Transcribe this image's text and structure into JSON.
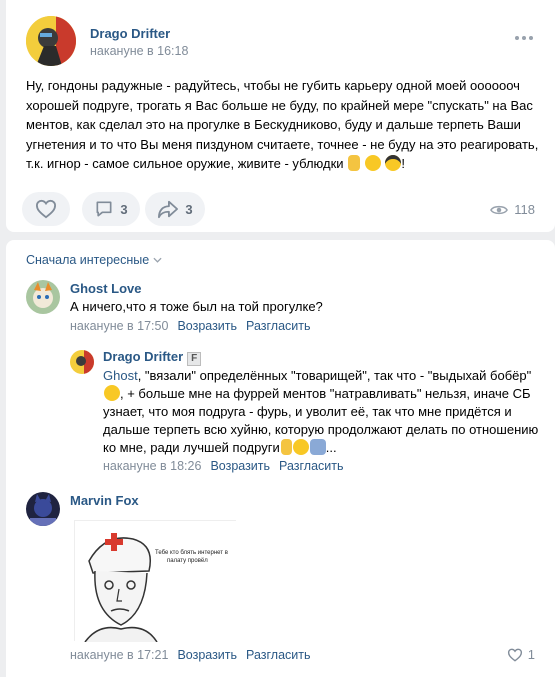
{
  "post": {
    "author": "Drago Drifter",
    "time": "накануне в 16:18",
    "text": "Ну, гондоны радужные - радуйтесь, чтобы не губить карьеру одной моей ооооооч хорошей подруге, трогать я Вас больше не буду, по крайней мере \"спускать\" на Вас ментов, как сделал это на прогулке в Бескудниково, буду и дальше терпеть Ваши угнетения и то что Вы меня пиздуном считаете, точнее - не буду на это реагировать, т.к. игнор - самое сильное оружие, живите - ублюдки",
    "text_end": "!",
    "comments_count": "3",
    "shares_count": "3",
    "views_count": "118"
  },
  "comments": {
    "sort_label": "Сначала интересные",
    "items": [
      {
        "author": "Ghost Love",
        "text": "А ничего,что я тоже был на той прогулке?",
        "time": "накануне в 17:50",
        "reply_label": "Возразить",
        "disagree_label": "Разгласить"
      },
      {
        "author": "Drago Drifter",
        "badge": "F",
        "mention": "Ghost",
        "text_a": ", \"вязали\" определённых \"товарищей\", так что - \"выдыхай бобёр\"",
        "text_b": ", + больше мне на фуррей ментов \"натравливать\" нельзя, иначе СБ узнает, что моя подруга - фурь, и уволит её, так что мне придётся и дальше терпеть всю хуйню, которую продолжают делать по отношению ко мне, ради лучшей подруги",
        "text_end": "...",
        "time": "накануне в 18:26",
        "reply_label": "Возразить",
        "disagree_label": "Разгласить"
      },
      {
        "author": "Marvin Fox",
        "meme_caption_1": "Тебе кто блять интернет в",
        "meme_caption_2": "палату провёл",
        "time": "накануне в 17:21",
        "reply_label": "Возразить",
        "disagree_label": "Разгласить",
        "likes": "1"
      }
    ]
  },
  "colors": {
    "link": "#2a5885",
    "meta": "#818c99",
    "page_bg": "#edeef0",
    "pill_bg": "#f0f2f5"
  },
  "icons": [
    "more-icon",
    "like-icon",
    "comment-icon",
    "share-icon",
    "eye-icon",
    "chevron-down-icon",
    "heart-icon"
  ]
}
